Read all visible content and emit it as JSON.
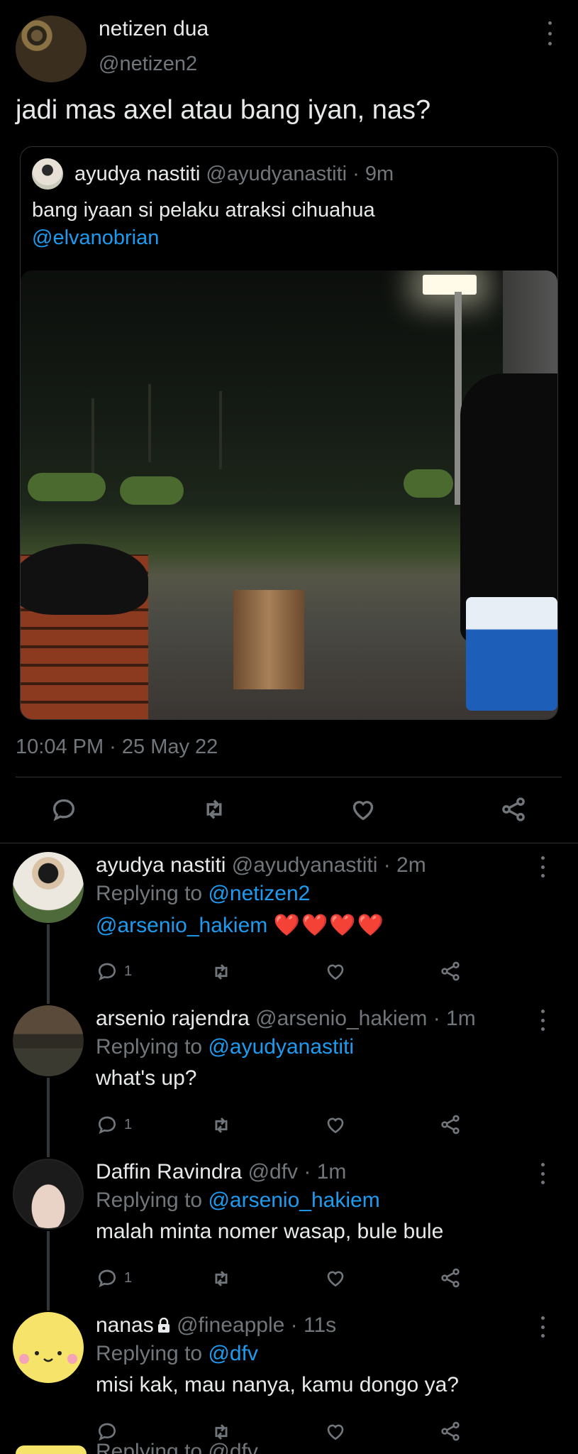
{
  "main_tweet": {
    "author_name": "netizen dua",
    "author_handle": "@netizen2",
    "text": "jadi mas axel atau bang iyan, nas?",
    "timestamp": "10:04 PM · 25 May 22",
    "quoted": {
      "author_name": "ayudya nastiti",
      "meta": "@ayudyanastiti · 9m",
      "text": "bang iyaan si pelaku atraksi cihuahua",
      "mention": "@elvanobrian"
    }
  },
  "replies": [
    {
      "name": "ayudya nastiti",
      "meta": "@ayudyanastiti · 2m",
      "replying_prefix": "Replying to ",
      "replying_to": "@netizen2",
      "text_mention": "@arsenio_hakiem",
      "text": "",
      "emoji": "❤️❤️❤️❤️",
      "reply_count": "1"
    },
    {
      "name": "arsenio rajendra",
      "meta": "@arsenio_hakiem · 1m",
      "replying_prefix": "Replying to ",
      "replying_to": "@ayudyanastiti",
      "text": "what's up?",
      "reply_count": "1"
    },
    {
      "name": "Daffin Ravindra",
      "meta": "@dfv · 1m",
      "replying_prefix": "Replying to ",
      "replying_to": "@arsenio_hakiem",
      "text": "malah minta nomer wasap, bule bule",
      "reply_count": "1"
    },
    {
      "name": "nanas",
      "meta": "@fineapple · 11s",
      "replying_prefix": "Replying to ",
      "replying_to": "@dfv",
      "text": "misi kak, mau nanya, kamu dongo ya?",
      "reply_count": ""
    }
  ],
  "cut_off_text": "Replying to @dfv",
  "icons": [
    "reply-icon",
    "retweet-icon",
    "like-icon",
    "share-icon",
    "more-icon",
    "lock-icon"
  ],
  "colors": {
    "background": "#000000",
    "text": "#e7e9ea",
    "muted": "#71767b",
    "link": "#1d9bf0",
    "heart": "#e0245e"
  }
}
